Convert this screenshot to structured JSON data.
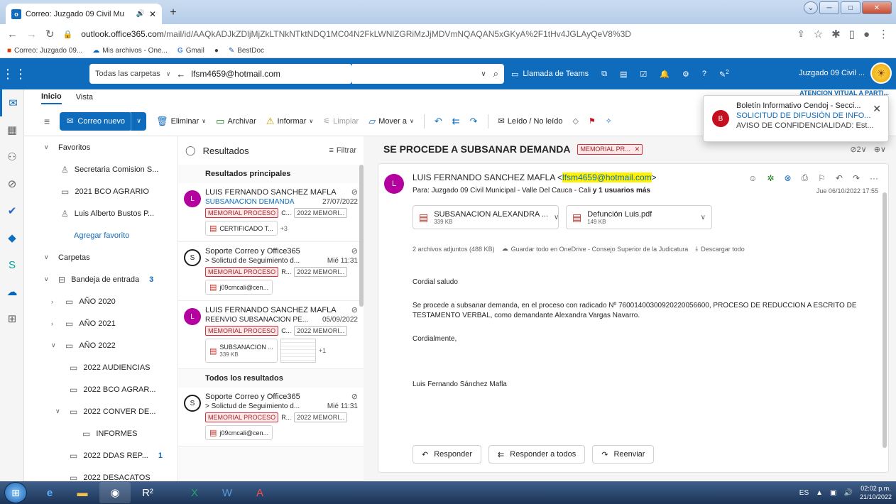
{
  "browser": {
    "tab_title": "Correo: Juzgado 09 Civil Mu",
    "url_host": "outlook.office365.com",
    "url_path": "/mail/id/AAQkADJkZDljMjZkLTNkNTktNDQ1MC04N2FkLWNlZGRiMzJjMDVmNQAQAN5xGKyA%2F1tHv4JGLAyQeV8%3D",
    "bookmarks": [
      "Correo: Juzgado 09...",
      "Mis archivos - One...",
      "Gmail",
      "BestDoc"
    ]
  },
  "header": {
    "scope": "Todas las carpetas",
    "search_value": "lfsm4659@hotmail.com",
    "teams": "Llamada de Teams",
    "badge": "2",
    "account": "Juzgado 09 Civil ..."
  },
  "ribbon": {
    "tabs": [
      "Inicio",
      "Vista"
    ],
    "notice": "ATENCION VITUAL A PARTI...",
    "new_mail": "Correo nuevo",
    "delete": "Eliminar",
    "archive": "Archivar",
    "report": "Informar",
    "clean": "Limpiar",
    "move": "Mover a",
    "read_unread": "Leído / No leído"
  },
  "folders": {
    "favorites": "Favoritos",
    "fav_items": [
      "Secretaria Comision S...",
      "2021 BCO AGRARIO",
      "Luis Alberto Bustos P..."
    ],
    "add_favorite": "Agregar favorito",
    "folders_label": "Carpetas",
    "inbox": "Bandeja de entrada",
    "inbox_count": "3",
    "items": [
      {
        "label": "AÑO 2020"
      },
      {
        "label": "AÑO 2021"
      },
      {
        "label": "AÑO 2022"
      },
      {
        "label": "2022 AUDIENCIAS"
      },
      {
        "label": "2022 BCO AGRAR..."
      },
      {
        "label": "2022 CONVER DE..."
      },
      {
        "label": "INFORMES"
      },
      {
        "label": "2022 DDAS REP...",
        "count": "1"
      },
      {
        "label": "2022 DESACATOS"
      }
    ]
  },
  "list": {
    "title": "Resultados",
    "filter": "Filtrar",
    "top_results": "Resultados principales",
    "all_results": "Todos los resultados",
    "mails": [
      {
        "avatar": "L",
        "from": "LUIS FERNANDO SANCHEZ MAFLA",
        "subject": "SUBSANACION DEMANDA",
        "date": "27/07/2022",
        "tag": "MEMORIAL PROCESO",
        "tag_more": "C...",
        "tag2": "2022 MEMORI...",
        "attachment": "CERTIFICADO T...",
        "extra": "+3"
      },
      {
        "avatar": "S",
        "from": "Soporte Correo y Office365",
        "subject": "> Solictud de Seguimiento d...",
        "date": "Mié 11:31",
        "tag": "MEMORIAL PROCESO",
        "tag_more": "R...",
        "tag2": "2022 MEMORI...",
        "attachment": "j09cmcali@cen..."
      },
      {
        "avatar": "L",
        "from": "LUIS FERNANDO SANCHEZ MAFLA",
        "subject": "REENVIO SUBSANACION PE...",
        "date": "05/09/2022",
        "tag": "MEMORIAL PROCESO",
        "tag_more": "C...",
        "tag2": "2022 MEMORI...",
        "attachment": "SUBSANACION ...",
        "attachment_size": "339 KB",
        "extra": "+1"
      },
      {
        "avatar": "S",
        "from": "Soporte Correo y Office365",
        "subject": "> Solictud de Seguimiento d...",
        "date": "Mié 11:31",
        "tag": "MEMORIAL PROCESO",
        "tag_more": "R...",
        "tag2": "2022 MEMORI...",
        "attachment": "j09cmcali@cen..."
      }
    ]
  },
  "reading": {
    "subject": "SE PROCEDE A SUBSANAR DEMANDA",
    "subject_tag": "MEMORIAL PR...",
    "tools": "2",
    "sender_name": "LUIS FERNANDO SANCHEZ MAFLA",
    "sender_email": "lfsm4659@hotmail.com",
    "to_prefix": "Para:",
    "to": "Juzgado 09 Civil Municipal - Valle Del Cauca - Cali",
    "to_more": "y 1 usuarios más",
    "date": "Jue 06/10/2022 17:55",
    "attachments": [
      {
        "name": "SUBSANACION ALEXANDRA ...",
        "size": "339 KB"
      },
      {
        "name": "Defunción Luis.pdf",
        "size": "149 KB"
      }
    ],
    "att_count": "2 archivos adjuntos (488 KB)",
    "save_all": "Guardar todo en OneDrive - Consejo Superior de la Judicatura",
    "download_all": "Descargar todo",
    "greeting": "Cordial saludo",
    "body": "Se procede a subsanar demanda, en el proceso con radicado Nº 76001400300920220056600, PROCESO DE REDUCCION A ESCRITO DE TESTAMENTO VERBAL, como demandante Alexandra Vargas Navarro.",
    "closing": "Cordialmente,",
    "signature": "Luis Fernando Sánchez Mafla",
    "reply": "Responder",
    "reply_all": "Responder a todos",
    "forward": "Reenviar"
  },
  "toast": {
    "avatar": "B",
    "line1": "Boletín Informativo Cendoj - Secci...",
    "line2": "SOLICITUD DE DIFUSIÓN DE INFO...",
    "line3": "AVISO DE CONFIDENCIALIDAD: Est..."
  },
  "taskbar": {
    "lang": "ES",
    "time": "02:02 p.m.",
    "date": "21/10/2022"
  }
}
